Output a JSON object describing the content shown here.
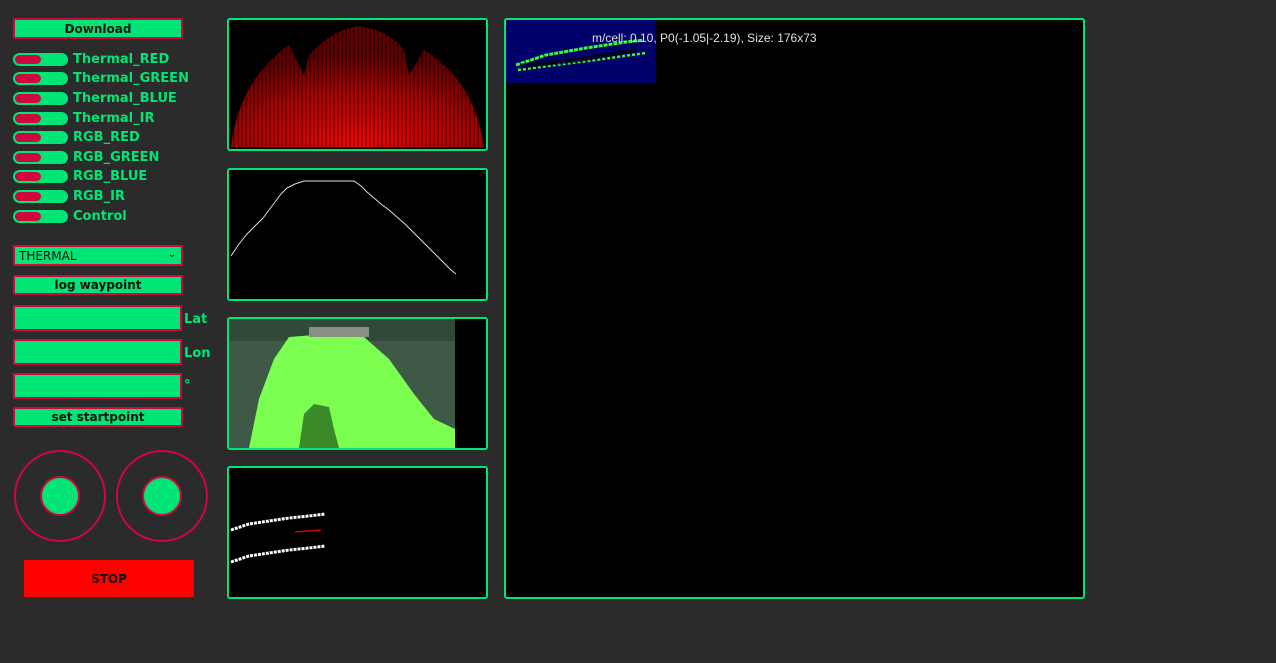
{
  "controls": {
    "download_label": "Download",
    "toggles": [
      {
        "label": "Thermal_RED"
      },
      {
        "label": "Thermal_GREEN"
      },
      {
        "label": "Thermal_BLUE"
      },
      {
        "label": "Thermal_IR"
      },
      {
        "label": "RGB_RED"
      },
      {
        "label": "RGB_GREEN"
      },
      {
        "label": "RGB_BLUE"
      },
      {
        "label": "RGB_IR"
      },
      {
        "label": "Control"
      }
    ],
    "mode_select": {
      "value": "THERMAL"
    },
    "log_waypoint_label": "log waypoint",
    "fields": [
      {
        "label": "Lat",
        "value": ""
      },
      {
        "label": "Lon",
        "value": ""
      },
      {
        "label": "°",
        "value": ""
      }
    ],
    "set_startpoint_label": "set startpoint",
    "stop_label": "STOP"
  },
  "map": {
    "info": "m/cell: 0.10, P0(-1.05|-2.19), Size: 176x73"
  },
  "colors": {
    "accent": "#00e676",
    "border": "#d0063e",
    "stop": "#ff0000",
    "background": "#2b2b2b"
  }
}
